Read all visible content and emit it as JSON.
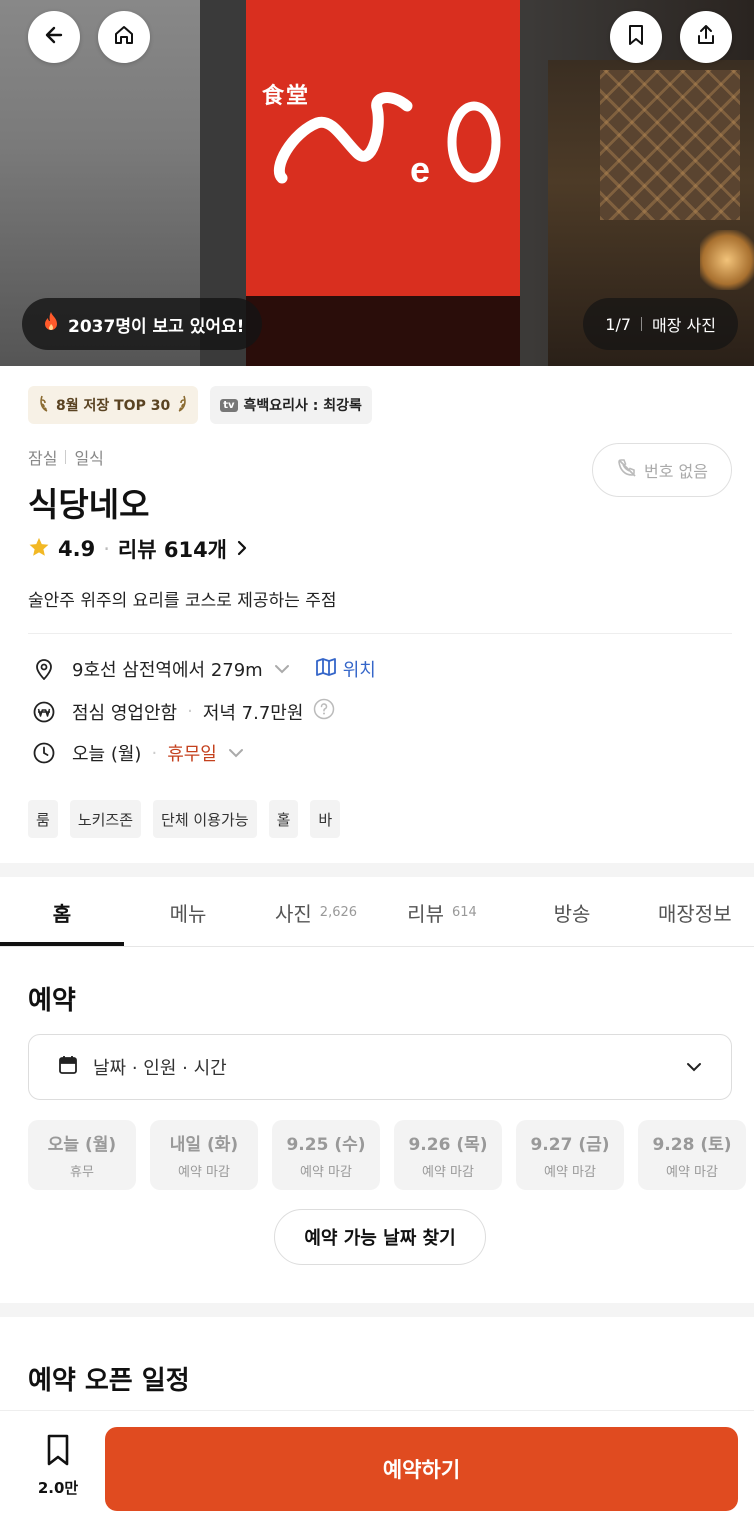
{
  "hero": {
    "logo_kanji": "食堂",
    "logo_text": "NeO",
    "viewers": "2037명이 보고 있어요!",
    "photo_counter": "1/7",
    "photo_label": "매장 사진"
  },
  "header_icons": {
    "back": "arrow-left-icon",
    "home": "home-icon",
    "bookmark": "bookmark-icon",
    "share": "share-icon"
  },
  "badges": [
    {
      "label": "8월 저장 TOP 30"
    },
    {
      "prefix": "tv",
      "label": "흑백요리사 : 최강록"
    }
  ],
  "restaurant": {
    "area": "잠실",
    "category": "일식",
    "name": "식당네오",
    "rating": "4.9",
    "reviews": "리뷰 614개",
    "description": "술안주 위주의 요리를 코스로 제공하는 주점",
    "phone_label": "번호 없음"
  },
  "info": {
    "location": "9호선 삼전역에서 279m",
    "map_link": "위치",
    "lunch": "점심 영업안함",
    "dinner": "저녁 7.7만원",
    "today": "오늘 (월)",
    "status": "휴무일"
  },
  "tags": [
    "룸",
    "노키즈존",
    "단체 이용가능",
    "홀",
    "바"
  ],
  "tabs": [
    {
      "label": "홈",
      "count": ""
    },
    {
      "label": "메뉴",
      "count": ""
    },
    {
      "label": "사진",
      "count": "2,626"
    },
    {
      "label": "리뷰",
      "count": "614"
    },
    {
      "label": "방송",
      "count": ""
    },
    {
      "label": "매장정보",
      "count": ""
    }
  ],
  "reserve": {
    "title": "예약",
    "selector": "날짜 · 인원 · 시간",
    "days": [
      {
        "date": "오늘 (월)",
        "status": "휴무"
      },
      {
        "date": "내일 (화)",
        "status": "예약 마감"
      },
      {
        "date": "9.25 (수)",
        "status": "예약 마감"
      },
      {
        "date": "9.26 (목)",
        "status": "예약 마감"
      },
      {
        "date": "9.27 (금)",
        "status": "예약 마감"
      },
      {
        "date": "9.28 (토)",
        "status": "예약 마감"
      }
    ],
    "find_button": "예약 가능 날짜 찾기",
    "schedule_title": "예약 오픈 일정"
  },
  "bottom": {
    "save_count": "2.0만",
    "reserve_button": "예약하기"
  },
  "colors": {
    "accent": "#e04b20",
    "sign_red": "#d92f1f",
    "closed": "#c4411e",
    "link": "#3566c9",
    "star": "#f2b824"
  }
}
